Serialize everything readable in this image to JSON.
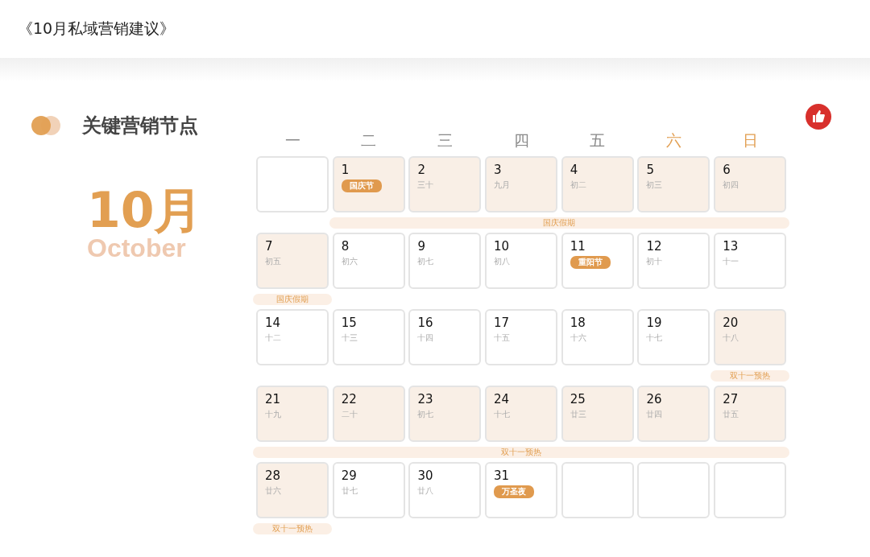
{
  "header": {
    "title": "《10月私域营销建议》"
  },
  "section": {
    "title": "关键营销节点"
  },
  "month": {
    "label": "10月",
    "english": "October"
  },
  "weekdays": [
    {
      "label": "一",
      "weekend": false
    },
    {
      "label": "二",
      "weekend": false
    },
    {
      "label": "三",
      "weekend": false
    },
    {
      "label": "四",
      "weekend": false
    },
    {
      "label": "五",
      "weekend": false
    },
    {
      "label": "六",
      "weekend": true
    },
    {
      "label": "日",
      "weekend": true
    }
  ],
  "weeks": [
    {
      "band": "国庆假期",
      "days": [
        {
          "kind": "blank",
          "highlighted": false
        },
        {
          "kind": "date",
          "day": "1",
          "festival": "国庆节",
          "highlighted": true
        },
        {
          "kind": "date",
          "day": "2",
          "lunar": "三十",
          "highlighted": true
        },
        {
          "kind": "date",
          "day": "3",
          "lunar": "九月",
          "highlighted": true
        },
        {
          "kind": "date",
          "day": "4",
          "lunar": "初二",
          "highlighted": true
        },
        {
          "kind": "date",
          "day": "5",
          "lunar": "初三",
          "highlighted": true
        },
        {
          "kind": "date",
          "day": "6",
          "lunar": "初四",
          "highlighted": true
        }
      ]
    },
    {
      "band": "国庆假期",
      "days": [
        {
          "kind": "date",
          "day": "7",
          "lunar": "初五",
          "highlighted": true
        },
        {
          "kind": "date",
          "day": "8",
          "lunar": "初六",
          "highlighted": false
        },
        {
          "kind": "date",
          "day": "9",
          "lunar": "初七",
          "highlighted": false
        },
        {
          "kind": "date",
          "day": "10",
          "lunar": "初八",
          "highlighted": false
        },
        {
          "kind": "date",
          "day": "11",
          "festival": "重阳节",
          "highlighted": false
        },
        {
          "kind": "date",
          "day": "12",
          "lunar": "初十",
          "highlighted": false
        },
        {
          "kind": "date",
          "day": "13",
          "lunar": "十一",
          "highlighted": false
        }
      ]
    },
    {
      "band": "双十一预热",
      "days": [
        {
          "kind": "date",
          "day": "14",
          "lunar": "十二",
          "highlighted": false
        },
        {
          "kind": "date",
          "day": "15",
          "lunar": "十三",
          "highlighted": false
        },
        {
          "kind": "date",
          "day": "16",
          "lunar": "十四",
          "highlighted": false
        },
        {
          "kind": "date",
          "day": "17",
          "lunar": "十五",
          "highlighted": false
        },
        {
          "kind": "date",
          "day": "18",
          "lunar": "十六",
          "highlighted": false
        },
        {
          "kind": "date",
          "day": "19",
          "lunar": "十七",
          "highlighted": false
        },
        {
          "kind": "date",
          "day": "20",
          "lunar": "十八",
          "highlighted": true
        }
      ]
    },
    {
      "band": "双十一预热",
      "days": [
        {
          "kind": "date",
          "day": "21",
          "lunar": "十九",
          "highlighted": true
        },
        {
          "kind": "date",
          "day": "22",
          "lunar": "二十",
          "highlighted": true
        },
        {
          "kind": "date",
          "day": "23",
          "lunar": "初七",
          "highlighted": true
        },
        {
          "kind": "date",
          "day": "24",
          "lunar": "十七",
          "highlighted": true
        },
        {
          "kind": "date",
          "day": "25",
          "lunar": "廿三",
          "highlighted": true
        },
        {
          "kind": "date",
          "day": "26",
          "lunar": "廿四",
          "highlighted": true
        },
        {
          "kind": "date",
          "day": "27",
          "lunar": "廿五",
          "highlighted": true
        }
      ]
    },
    {
      "band": "双十一预热",
      "days": [
        {
          "kind": "date",
          "day": "28",
          "lunar": "廿六",
          "highlighted": true
        },
        {
          "kind": "date",
          "day": "29",
          "lunar": "廿七",
          "highlighted": false
        },
        {
          "kind": "date",
          "day": "30",
          "lunar": "廿八",
          "highlighted": false
        },
        {
          "kind": "date",
          "day": "31",
          "festival": "万圣夜",
          "highlighted": false
        },
        {
          "kind": "blank",
          "highlighted": false
        },
        {
          "kind": "blank",
          "highlighted": false
        },
        {
          "kind": "blank",
          "highlighted": false
        }
      ]
    }
  ]
}
